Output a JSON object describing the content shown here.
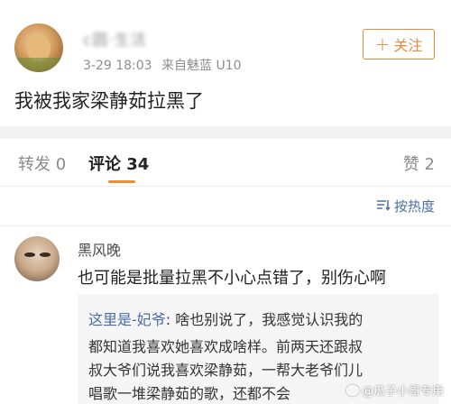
{
  "post": {
    "username": "c圆·生活",
    "time": "3-29 18:03",
    "source": "来自魅蓝 U10",
    "follow_label": "关注",
    "text": "我被我家梁静茹拉黑了"
  },
  "tabs": {
    "repost": "转发 0",
    "comment": "评论 34",
    "like": "赞 2"
  },
  "sort": {
    "label": "按热度",
    "icon": "sort-icon"
  },
  "comment": {
    "name": "黑风晚",
    "text": "也可能是批量拉黑不小心点错了，别伤心啊",
    "reply": {
      "name": "这里是-妃爷",
      "line1": ": 啥也别说了，我感觉认识我的",
      "line2": "都知道我喜欢她喜欢成啥样。前两天还跟叔",
      "line3": "叔大爷们说我喜欢梁静茹，一帮大老爷们儿",
      "line4": "唱歌一堆梁静茹的歌，还都不会"
    }
  },
  "watermark": "@瓜子小哥专用",
  "colors": {
    "accent": "#f08b32",
    "follow": "#e58b3c",
    "link": "#4a6fa5"
  }
}
